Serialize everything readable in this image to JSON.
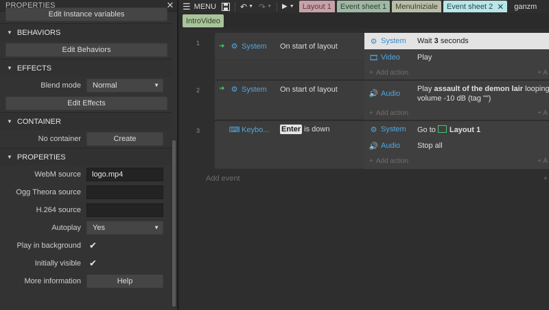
{
  "properties_panel": {
    "title": "PROPERTIES",
    "edit_instance_variables": "Edit Instance variables",
    "behaviors": {
      "header": "BEHAVIORS",
      "button": "Edit Behaviors"
    },
    "effects": {
      "header": "EFFECTS",
      "blend_mode_label": "Blend mode",
      "blend_mode_value": "Normal",
      "button": "Edit Effects"
    },
    "container": {
      "header": "CONTAINER",
      "label": "No container",
      "button": "Create"
    },
    "properties": {
      "header": "PROPERTIES",
      "webm_label": "WebM source",
      "webm_value": "logo.mp4",
      "ogg_label": "Ogg Theora source",
      "ogg_value": "",
      "h264_label": "H.264 source",
      "h264_value": "",
      "autoplay_label": "Autoplay",
      "autoplay_value": "Yes",
      "play_bg_label": "Play in background",
      "play_bg_checked": true,
      "visible_label": "Initially visible",
      "visible_checked": true,
      "more_info_label": "More information",
      "help_button": "Help"
    }
  },
  "toolbar": {
    "menu_label": "MENU",
    "tabs": [
      "Layout 1",
      "Event sheet 1",
      "MenuIniziale",
      "Event sheet 2"
    ],
    "active_tab": "Event sheet 2",
    "user": "ganzm",
    "second_row_tab": "IntroVideo"
  },
  "events": [
    {
      "number": "1",
      "condition_object": "System",
      "condition_text": "On start of layout",
      "actions": [
        {
          "object": "System",
          "text_pre": "Wait ",
          "text_bold": "3",
          "text_post": " seconds"
        },
        {
          "object": "Video",
          "text": "Play"
        }
      ],
      "add_action": "Add action"
    },
    {
      "number": "2",
      "condition_object": "System",
      "condition_text": "On start of layout",
      "actions": [
        {
          "object": "Audio",
          "line1_pre": "Play ",
          "line1_bold": "assault of the demon lair",
          "line1_post": " looping at",
          "line2": "volume -10 dB (tag \"\")"
        }
      ],
      "add_action": "Add action"
    },
    {
      "number": "3",
      "condition_object": "Keybo...",
      "condition_key": "Enter",
      "condition_text": " is down",
      "actions": [
        {
          "object": "System",
          "text_pre": "Go to ",
          "text_bold": "Layout 1"
        },
        {
          "object": "Audio",
          "text": "Stop all"
        }
      ],
      "add_action": "Add action"
    }
  ],
  "add_event": "Add event",
  "colors": {
    "accent_blue": "#52a7e0",
    "trigger_green": "#47c96d",
    "highlight_row": "#e3e3e3"
  }
}
